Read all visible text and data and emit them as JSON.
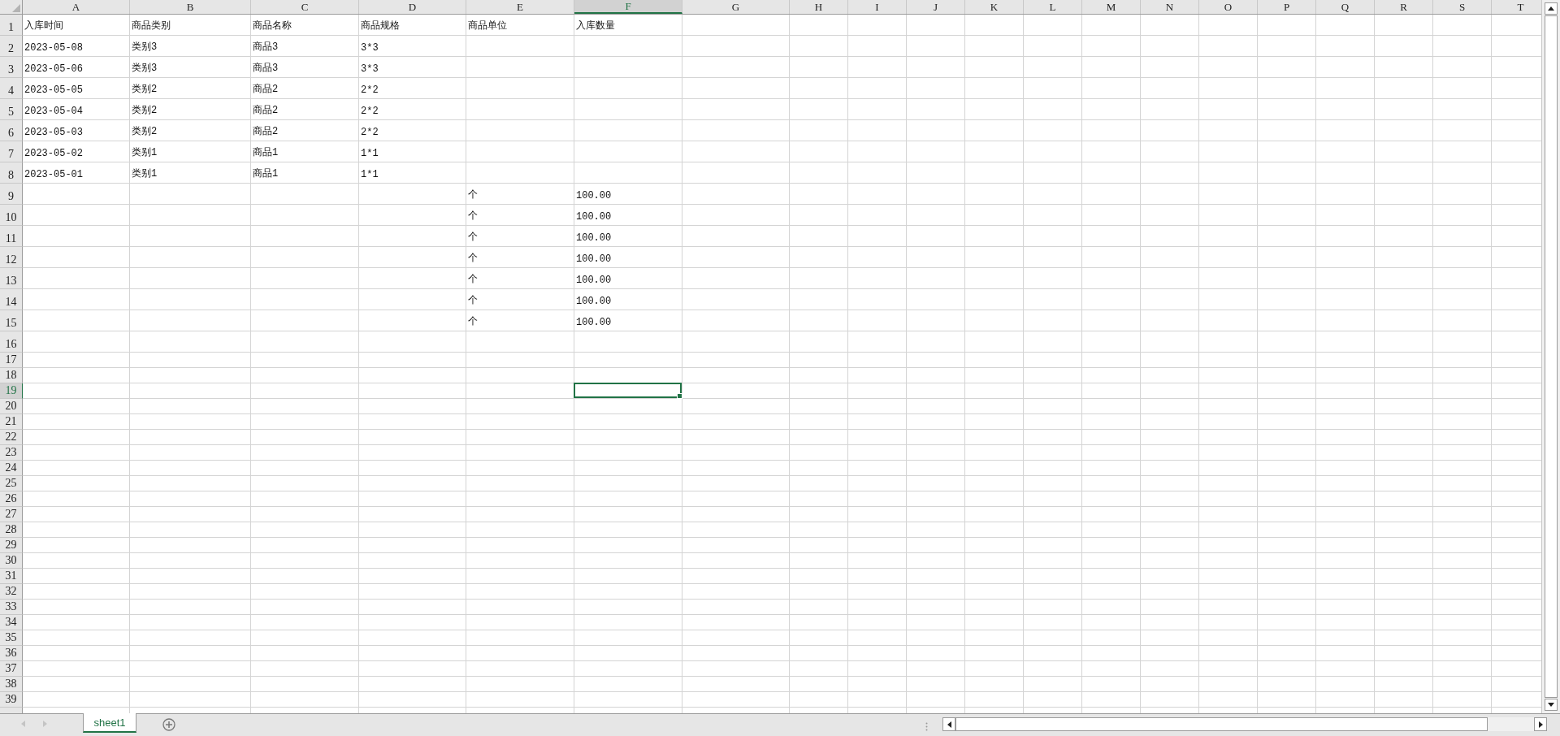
{
  "columns": [
    {
      "label": "A",
      "selected": false
    },
    {
      "label": "B",
      "selected": false
    },
    {
      "label": "C",
      "selected": false
    },
    {
      "label": "D",
      "selected": false
    },
    {
      "label": "E",
      "selected": false
    },
    {
      "label": "F",
      "selected": true
    },
    {
      "label": "G",
      "selected": false
    },
    {
      "label": "H",
      "selected": false
    },
    {
      "label": "I",
      "selected": false
    },
    {
      "label": "J",
      "selected": false
    },
    {
      "label": "K",
      "selected": false
    },
    {
      "label": "L",
      "selected": false
    },
    {
      "label": "M",
      "selected": false
    },
    {
      "label": "N",
      "selected": false
    },
    {
      "label": "O",
      "selected": false
    },
    {
      "label": "P",
      "selected": false
    },
    {
      "label": "Q",
      "selected": false
    },
    {
      "label": "R",
      "selected": false
    },
    {
      "label": "S",
      "selected": false
    },
    {
      "label": "T",
      "selected": false
    }
  ],
  "rows": [
    {
      "label": "1",
      "selected": false,
      "cells": [
        "入库时间",
        "商品类别",
        "商品名称",
        "商品规格",
        "商品单位",
        "入库数量"
      ]
    },
    {
      "label": "2",
      "selected": false,
      "cells": [
        "2023-05-08",
        "类别3",
        "商品3",
        "3*3"
      ]
    },
    {
      "label": "3",
      "selected": false,
      "cells": [
        "2023-05-06",
        "类别3",
        "商品3",
        "3*3"
      ]
    },
    {
      "label": "4",
      "selected": false,
      "cells": [
        "2023-05-05",
        "类别2",
        "商品2",
        "2*2"
      ]
    },
    {
      "label": "5",
      "selected": false,
      "cells": [
        "2023-05-04",
        "类别2",
        "商品2",
        "2*2"
      ]
    },
    {
      "label": "6",
      "selected": false,
      "cells": [
        "2023-05-03",
        "类别2",
        "商品2",
        "2*2"
      ]
    },
    {
      "label": "7",
      "selected": false,
      "cells": [
        "2023-05-02",
        "类别1",
        "商品1",
        "1*1"
      ]
    },
    {
      "label": "8",
      "selected": false,
      "cells": [
        "2023-05-01",
        "类别1",
        "商品1",
        "1*1"
      ]
    },
    {
      "label": "9",
      "selected": false,
      "cells": [
        null,
        null,
        null,
        null,
        "个",
        "100.00"
      ]
    },
    {
      "label": "10",
      "selected": false,
      "cells": [
        null,
        null,
        null,
        null,
        "个",
        "100.00"
      ]
    },
    {
      "label": "11",
      "selected": false,
      "cells": [
        null,
        null,
        null,
        null,
        "个",
        "100.00"
      ]
    },
    {
      "label": "12",
      "selected": false,
      "cells": [
        null,
        null,
        null,
        null,
        "个",
        "100.00"
      ]
    },
    {
      "label": "13",
      "selected": false,
      "cells": [
        null,
        null,
        null,
        null,
        "个",
        "100.00"
      ]
    },
    {
      "label": "14",
      "selected": false,
      "cells": [
        null,
        null,
        null,
        null,
        "个",
        "100.00"
      ]
    },
    {
      "label": "15",
      "selected": false,
      "cells": [
        null,
        null,
        null,
        null,
        "个",
        "100.00"
      ]
    },
    {
      "label": "16",
      "selected": false
    },
    {
      "label": "17",
      "selected": false
    },
    {
      "label": "18",
      "selected": false
    },
    {
      "label": "19",
      "selected": true
    },
    {
      "label": "20",
      "selected": false
    },
    {
      "label": "21",
      "selected": false
    },
    {
      "label": "22",
      "selected": false
    },
    {
      "label": "23",
      "selected": false
    },
    {
      "label": "24",
      "selected": false
    },
    {
      "label": "25",
      "selected": false
    },
    {
      "label": "26",
      "selected": false
    },
    {
      "label": "27",
      "selected": false
    },
    {
      "label": "28",
      "selected": false
    },
    {
      "label": "29",
      "selected": false
    },
    {
      "label": "30",
      "selected": false
    },
    {
      "label": "31",
      "selected": false
    },
    {
      "label": "32",
      "selected": false
    },
    {
      "label": "33",
      "selected": false
    },
    {
      "label": "34",
      "selected": false
    },
    {
      "label": "35",
      "selected": false
    },
    {
      "label": "36",
      "selected": false
    },
    {
      "label": "37",
      "selected": false
    },
    {
      "label": "38",
      "selected": false
    },
    {
      "label": "39",
      "selected": false
    },
    {
      "selected": false
    }
  ],
  "sheet_tabs": [
    {
      "label": "sheet1",
      "selected": true
    }
  ]
}
